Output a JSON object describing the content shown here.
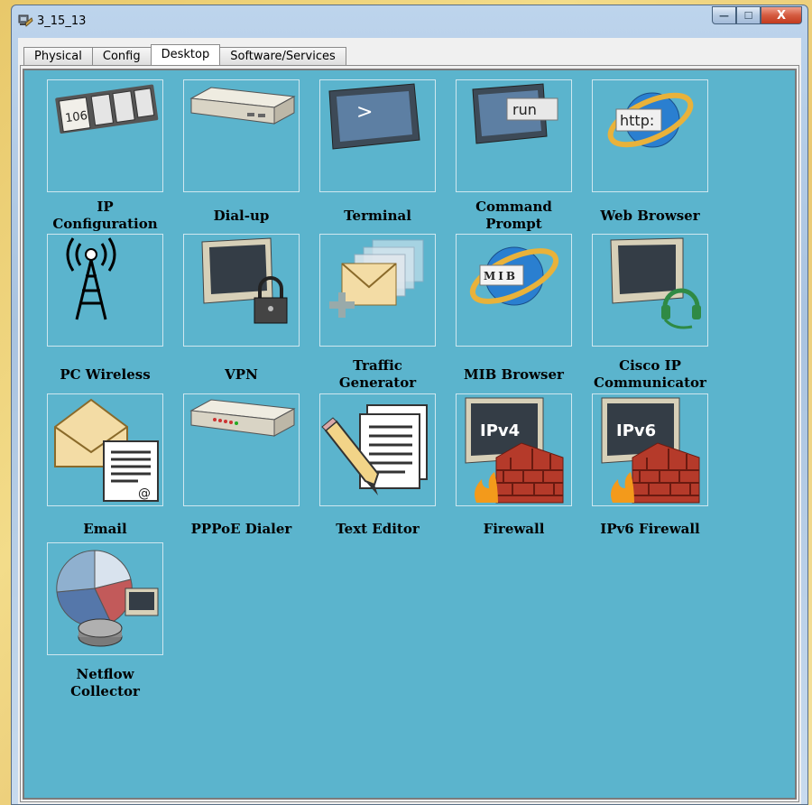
{
  "window": {
    "title": "3_15_13"
  },
  "window_controls": {
    "minimize": "—",
    "maximize": "☐",
    "close": "X"
  },
  "tabs": [
    {
      "label": "Physical",
      "active": false
    },
    {
      "label": "Config",
      "active": false
    },
    {
      "label": "Desktop",
      "active": true
    },
    {
      "label": "Software/Services",
      "active": false
    }
  ],
  "desktop": {
    "background_color": "#5bb4cd",
    "apps": [
      {
        "label_lines": [
          "IP",
          "Configuration"
        ],
        "icon": "ip-configuration-icon",
        "icon_text": "106"
      },
      {
        "label_lines": [
          "Dial-up"
        ],
        "icon": "dial-up-modem-icon"
      },
      {
        "label_lines": [
          "Terminal"
        ],
        "icon": "terminal-icon",
        "icon_text": ">"
      },
      {
        "label_lines": [
          "Command",
          "Prompt"
        ],
        "icon": "command-prompt-icon",
        "icon_text": "run"
      },
      {
        "label_lines": [
          "Web Browser"
        ],
        "icon": "web-browser-icon",
        "icon_text": "http:"
      },
      {
        "label_lines": [
          "PC Wireless"
        ],
        "icon": "wireless-tower-icon"
      },
      {
        "label_lines": [
          "VPN"
        ],
        "icon": "vpn-lock-icon"
      },
      {
        "label_lines": [
          "Traffic",
          "Generator"
        ],
        "icon": "traffic-generator-icon"
      },
      {
        "label_lines": [
          "MIB Browser"
        ],
        "icon": "mib-browser-icon",
        "icon_text": "MIB"
      },
      {
        "label_lines": [
          "Cisco IP",
          "Communicator"
        ],
        "icon": "ip-communicator-headset-icon"
      },
      {
        "label_lines": [
          "Email"
        ],
        "icon": "email-icon",
        "icon_text": "@"
      },
      {
        "label_lines": [
          "PPPoE Dialer"
        ],
        "icon": "pppoe-dialer-icon"
      },
      {
        "label_lines": [
          "Text Editor"
        ],
        "icon": "text-editor-icon"
      },
      {
        "label_lines": [
          "Firewall"
        ],
        "icon": "firewall-icon",
        "icon_text": "IPv4"
      },
      {
        "label_lines": [
          "IPv6 Firewall"
        ],
        "icon": "ipv6-firewall-icon",
        "icon_text": "IPv6"
      },
      {
        "label_lines": [
          "Netflow",
          "Collector"
        ],
        "icon": "netflow-collector-icon"
      }
    ]
  }
}
